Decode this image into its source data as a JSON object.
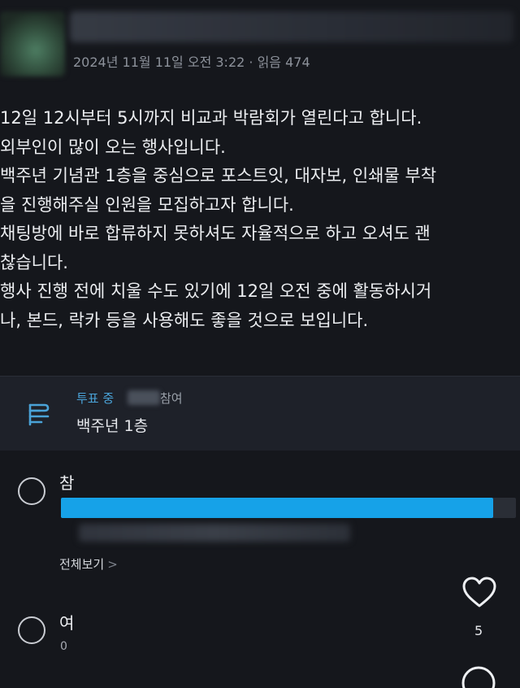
{
  "post": {
    "meta": "2024년 11월 11일 오전 3:22 · 읽음 474",
    "body_lines": [
      "12일 12시부터 5시까지 비교과 박람회가 열린다고 합니다.",
      "외부인이 많이 오는 행사입니다.",
      "백주년 기념관 1층을 중심으로 포스트잇, 대자보, 인쇄물 부착",
      "을 진행해주실 인원을 모집하고자 합니다.",
      "채팅방에 바로 합류하지 못하셔도 자율적으로 하고 오셔도 괜",
      "찮습니다.",
      "행사 진행 전에 치울 수도 있기에 12일 오전 중에 활동하시거",
      "나, 본드, 락카 등을 사용해도 좋을 것으로 보입니다."
    ]
  },
  "poll": {
    "status": "투표 중",
    "participate_suffix": "참여",
    "title": "백주년 1층",
    "options": [
      {
        "label": "참",
        "fill": 0.95,
        "see_all": "전체보기",
        "see_all_chevron": ">"
      },
      {
        "label": "여",
        "count": "0"
      }
    ]
  },
  "actions": {
    "like_count": "5",
    "icons": [
      "heart-icon",
      "comment-icon",
      "poll-icon"
    ]
  },
  "colors": {
    "accent": "#16a2e8",
    "status_blue": "#4aa3d8",
    "background": "#15171c"
  }
}
